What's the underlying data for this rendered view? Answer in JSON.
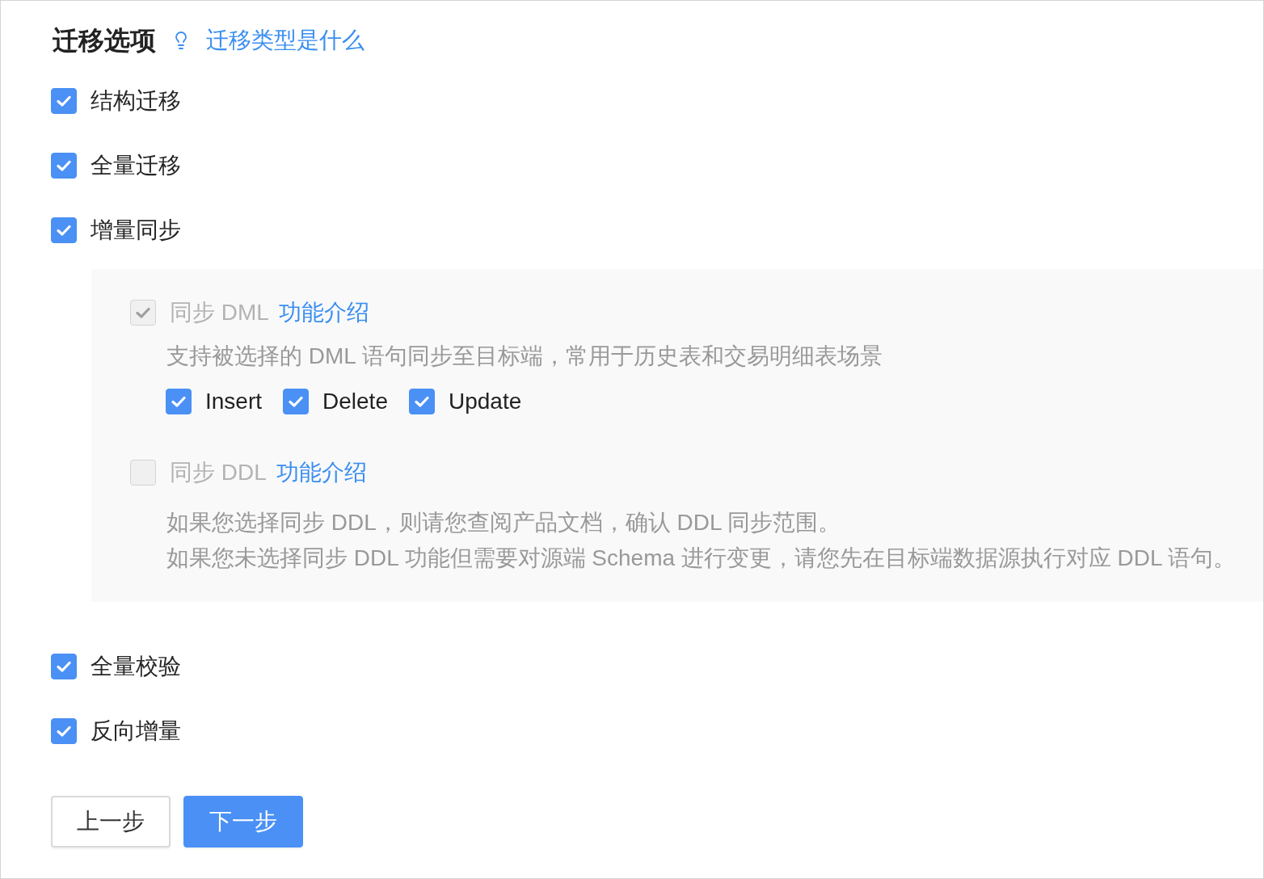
{
  "section": {
    "title": "迁移选项",
    "help_link": "迁移类型是什么"
  },
  "options": [
    {
      "label": "结构迁移",
      "checked": true
    },
    {
      "label": "全量迁移",
      "checked": true
    },
    {
      "label": "增量同步",
      "checked": true,
      "settings": [
        {
          "label": "同步 DML",
          "link": "功能介绍",
          "checked": true,
          "disabled": true,
          "description": [
            "支持被选择的 DML 语句同步至目标端，常用于历史表和交易明细表场景"
          ],
          "operations": [
            {
              "label": "Insert",
              "checked": true
            },
            {
              "label": "Delete",
              "checked": true
            },
            {
              "label": "Update",
              "checked": true
            }
          ]
        },
        {
          "label": "同步 DDL",
          "link": "功能介绍",
          "checked": false,
          "disabled": true,
          "description": [
            "如果您选择同步 DDL，则请您查阅产品文档，确认 DDL 同步范围。",
            "如果您未选择同步 DDL 功能但需要对源端 Schema 进行变更，请您先在目标端数据源执行对应 DDL 语句。"
          ]
        }
      ]
    },
    {
      "label": "全量校验",
      "checked": true
    },
    {
      "label": "反向增量",
      "checked": true
    }
  ],
  "buttons": [
    {
      "label": "上一步",
      "kind": "secondary"
    },
    {
      "label": "下一步",
      "kind": "primary"
    }
  ]
}
